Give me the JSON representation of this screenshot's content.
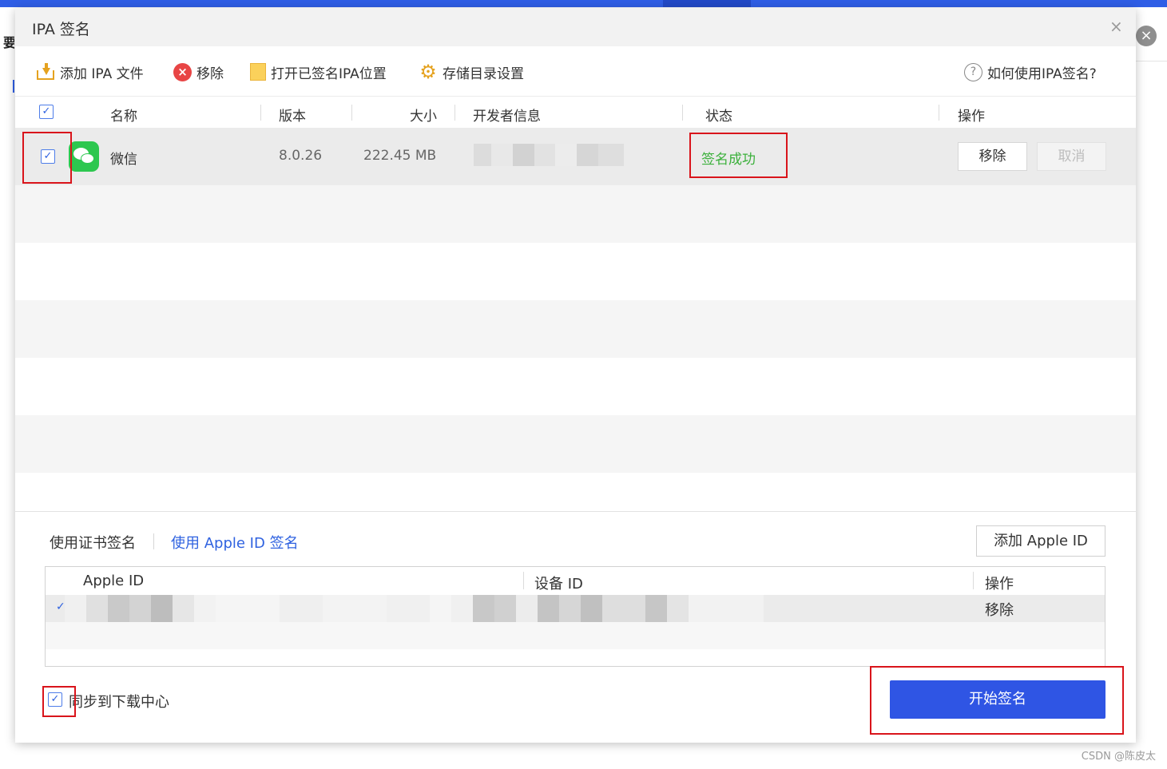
{
  "background": {
    "left_char": "要",
    "watermark": "CSDN @陈皮太"
  },
  "dialog": {
    "title": "IPA 签名",
    "close_icon": "×"
  },
  "toolbar": {
    "add_ipa": "添加 IPA 文件",
    "remove": "移除",
    "open_signed": "打开已签名IPA位置",
    "storage_settings": "存储目录设置",
    "help": "如何使用IPA签名?"
  },
  "table": {
    "headers": {
      "name": "名称",
      "version": "版本",
      "size": "大小",
      "developer": "开发者信息",
      "status": "状态",
      "actions": "操作"
    },
    "rows": [
      {
        "checked": true,
        "icon": "wechat-icon",
        "name": "微信",
        "version": "8.0.26",
        "size": "222.45 MB",
        "developer": "",
        "status": "签名成功",
        "remove_label": "移除",
        "cancel_label": "取消"
      }
    ]
  },
  "signing": {
    "tab_certificate": "使用证书签名",
    "tab_apple_id": "使用 Apple ID 签名",
    "add_apple_id": "添加 Apple ID",
    "apple_id_table": {
      "headers": {
        "apple_id": "Apple ID",
        "device_id": "设备 ID",
        "actions": "操作"
      },
      "rows": [
        {
          "selected": true,
          "apple_id": "",
          "device_id": "",
          "action": "移除"
        }
      ]
    },
    "sync_label": "同步到下载中心",
    "start_button": "开始签名"
  },
  "colors": {
    "accent": "#2f55e4",
    "success": "#3bb03b",
    "highlight_box": "#d9141b"
  }
}
